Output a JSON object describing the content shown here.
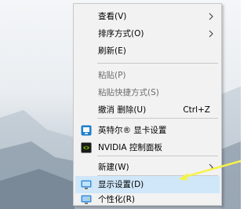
{
  "context_menu": {
    "items": [
      {
        "label": "查看(V)",
        "icon": "",
        "shortcut": "",
        "submenu": true,
        "enabled": true
      },
      {
        "label": "排序方式(O)",
        "icon": "",
        "shortcut": "",
        "submenu": true,
        "enabled": true
      },
      {
        "label": "刷新(E)",
        "icon": "",
        "shortcut": "",
        "submenu": false,
        "enabled": true
      },
      {
        "label": "粘贴(P)",
        "icon": "",
        "shortcut": "",
        "submenu": false,
        "enabled": false
      },
      {
        "label": "粘贴快捷方式(S)",
        "icon": "",
        "shortcut": "",
        "submenu": false,
        "enabled": false
      },
      {
        "label": "撤消 删除(U)",
        "icon": "",
        "shortcut": "Ctrl+Z",
        "submenu": false,
        "enabled": true
      },
      {
        "label": "英特尔® 显卡设置",
        "icon": "intel-graphics-icon",
        "shortcut": "",
        "submenu": false,
        "enabled": true
      },
      {
        "label": "NVIDIA 控制面板",
        "icon": "nvidia-icon",
        "shortcut": "",
        "submenu": false,
        "enabled": true
      },
      {
        "label": "新建(W)",
        "icon": "",
        "shortcut": "",
        "submenu": true,
        "enabled": true
      },
      {
        "label": "显示设置(D)",
        "icon": "display-settings-icon",
        "shortcut": "",
        "submenu": false,
        "enabled": true,
        "highlighted": true
      },
      {
        "label": "个性化(R)",
        "icon": "personalize-icon",
        "shortcut": "",
        "submenu": false,
        "enabled": true
      }
    ]
  },
  "colors": {
    "menu_bg": "#f2f2f2",
    "highlight": "#d0e7f9",
    "disabled_text": "#6d6d6d",
    "annotation_arrow": "#f7f24a"
  }
}
